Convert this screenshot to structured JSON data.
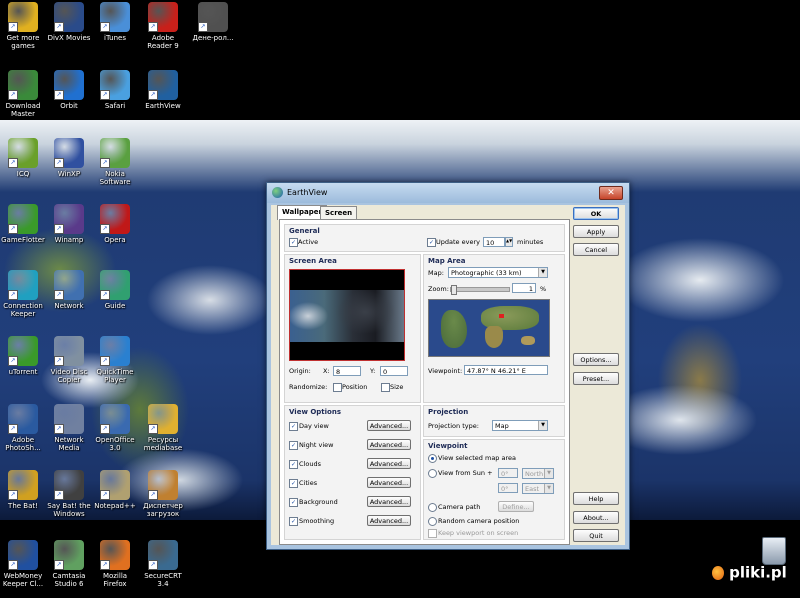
{
  "desktop": {
    "icons": [
      {
        "label": "Get more games",
        "icon": "games-icon",
        "color": "#e0b020"
      },
      {
        "label": "DivX Movies",
        "icon": "divx-icon",
        "color": "#2a4b8a"
      },
      {
        "label": "iTunes",
        "icon": "itunes-icon",
        "color": "#4a8fd8"
      },
      {
        "label": "Adobe Reader 9",
        "icon": "adobe-reader-icon",
        "color": "#c8201a"
      },
      {
        "label": "Дене-рол...",
        "icon": "clapper-icon",
        "color": "#505050"
      },
      {
        "label": "Download Master",
        "icon": "download-master-icon",
        "color": "#3a8a3a"
      },
      {
        "label": "Orbit",
        "icon": "orbit-icon",
        "color": "#2070d0"
      },
      {
        "label": "Safari",
        "icon": "safari-icon",
        "color": "#4aa0e0"
      },
      {
        "label": "EarthView",
        "icon": "earthview-icon",
        "color": "#2060a0"
      },
      {
        "label": "ICQ",
        "icon": "icq-icon",
        "color": "#6aa02a"
      },
      {
        "label": "WinXP",
        "icon": "winxp-icon",
        "color": "#3050a0"
      },
      {
        "label": "Nokia Software",
        "icon": "nokia-icon",
        "color": "#5aa040"
      },
      {
        "label": "GameFlotter",
        "icon": "utorrent-icon",
        "color": "#3a9a2a"
      },
      {
        "label": "Winamp",
        "icon": "winamp-icon",
        "color": "#5a3a8a"
      },
      {
        "label": "Opera",
        "icon": "opera-icon",
        "color": "#c01818"
      },
      {
        "label": "Connection Keeper",
        "icon": "connection-icon",
        "color": "#20a0c0"
      },
      {
        "label": "Network",
        "icon": "network-icon",
        "color": "#4070b0"
      },
      {
        "label": "Guide",
        "icon": "guide-icon",
        "color": "#30a070"
      },
      {
        "label": "uTorrent",
        "icon": "utorrent-icon",
        "color": "#3a9a2a"
      },
      {
        "label": "Video Disc Copier",
        "icon": "disc-icon",
        "color": "#8090a0"
      },
      {
        "label": "QuickTime Player",
        "icon": "quicktime-icon",
        "color": "#2a80d0"
      },
      {
        "label": "Adobe PhotoSh...",
        "icon": "photoshop-icon",
        "color": "#2a5aa0"
      },
      {
        "label": "Network Media",
        "icon": "media-icon",
        "color": "#7080a0"
      },
      {
        "label": "OpenOffice 3.0",
        "icon": "openoffice-icon",
        "color": "#3a6ab0"
      },
      {
        "label": "Ресурсы mediabase",
        "icon": "folder-icon",
        "color": "#e0b030"
      },
      {
        "label": "The Bat!",
        "icon": "thebat-icon",
        "color": "#d0a020"
      },
      {
        "label": "Say Bat! the Windows",
        "icon": "windows-icon",
        "color": "#404040"
      },
      {
        "label": "Notepad++",
        "icon": "notepad-icon",
        "color": "#b0a070"
      },
      {
        "label": "Диспетчер загрузок",
        "icon": "manager-icon",
        "color": "#c08030"
      },
      {
        "label": "WebMoney Keeper Cl...",
        "icon": "webmoney-icon",
        "color": "#2050a0"
      },
      {
        "label": "Camtasia Studio 6",
        "icon": "camtasia-icon",
        "color": "#60a060"
      },
      {
        "label": "Mozilla Firefox",
        "icon": "firefox-icon",
        "color": "#e07020"
      },
      {
        "label": "SecureCRT 3.4",
        "icon": "securecrt-icon",
        "color": "#3a6a90"
      }
    ],
    "recycle_bin_icon": "recycle-bin-icon",
    "watermark": "pliki.pl"
  },
  "dialog": {
    "title": "EarthView",
    "tabs": [
      "Wallpaper",
      "Screen Saver"
    ],
    "active_tab": "Wallpaper",
    "general": {
      "title": "General",
      "active_label": "Active",
      "update_label": "Update every",
      "update_value": "10",
      "update_unit": "minutes"
    },
    "screen_area": {
      "title": "Screen Area",
      "origin_label": "Origin:",
      "x_label": "X:",
      "x_value": "8",
      "y_label": "Y:",
      "y_value": "0",
      "randomize_label": "Randomize:",
      "position_label": "Position",
      "size_label": "Size"
    },
    "map_area": {
      "title": "Map Area",
      "map_label": "Map:",
      "map_value": "Photographic (33 km)",
      "zoom_label": "Zoom:",
      "zoom_value": "1",
      "zoom_unit": "%",
      "viewpoint_label": "Viewpoint:",
      "viewpoint_value": "47.87° N  46.21° E"
    },
    "view_options": {
      "title": "View Options",
      "items": [
        "Day view",
        "Night view",
        "Clouds",
        "Cities",
        "Background",
        "Smoothing"
      ],
      "advanced_label": "Advanced..."
    },
    "projection": {
      "title": "Projection",
      "type_label": "Projection type:",
      "type_value": "Map"
    },
    "viewpoint": {
      "title": "Viewpoint",
      "view_selected": "View selected map area",
      "view_from_sun": "View from Sun +",
      "lat_value": "0°",
      "lat_dir": "North",
      "lon_value": "0°",
      "lon_dir": "East",
      "camera_path": "Camera path",
      "define_label": "Define...",
      "random_camera": "Random camera position",
      "keep_viewport": "Keep viewport on screen"
    },
    "side_buttons": {
      "ok": "OK",
      "apply": "Apply",
      "cancel": "Cancel",
      "options": "Options...",
      "preset": "Preset...",
      "help": "Help",
      "about": "About...",
      "quit": "Quit"
    }
  }
}
